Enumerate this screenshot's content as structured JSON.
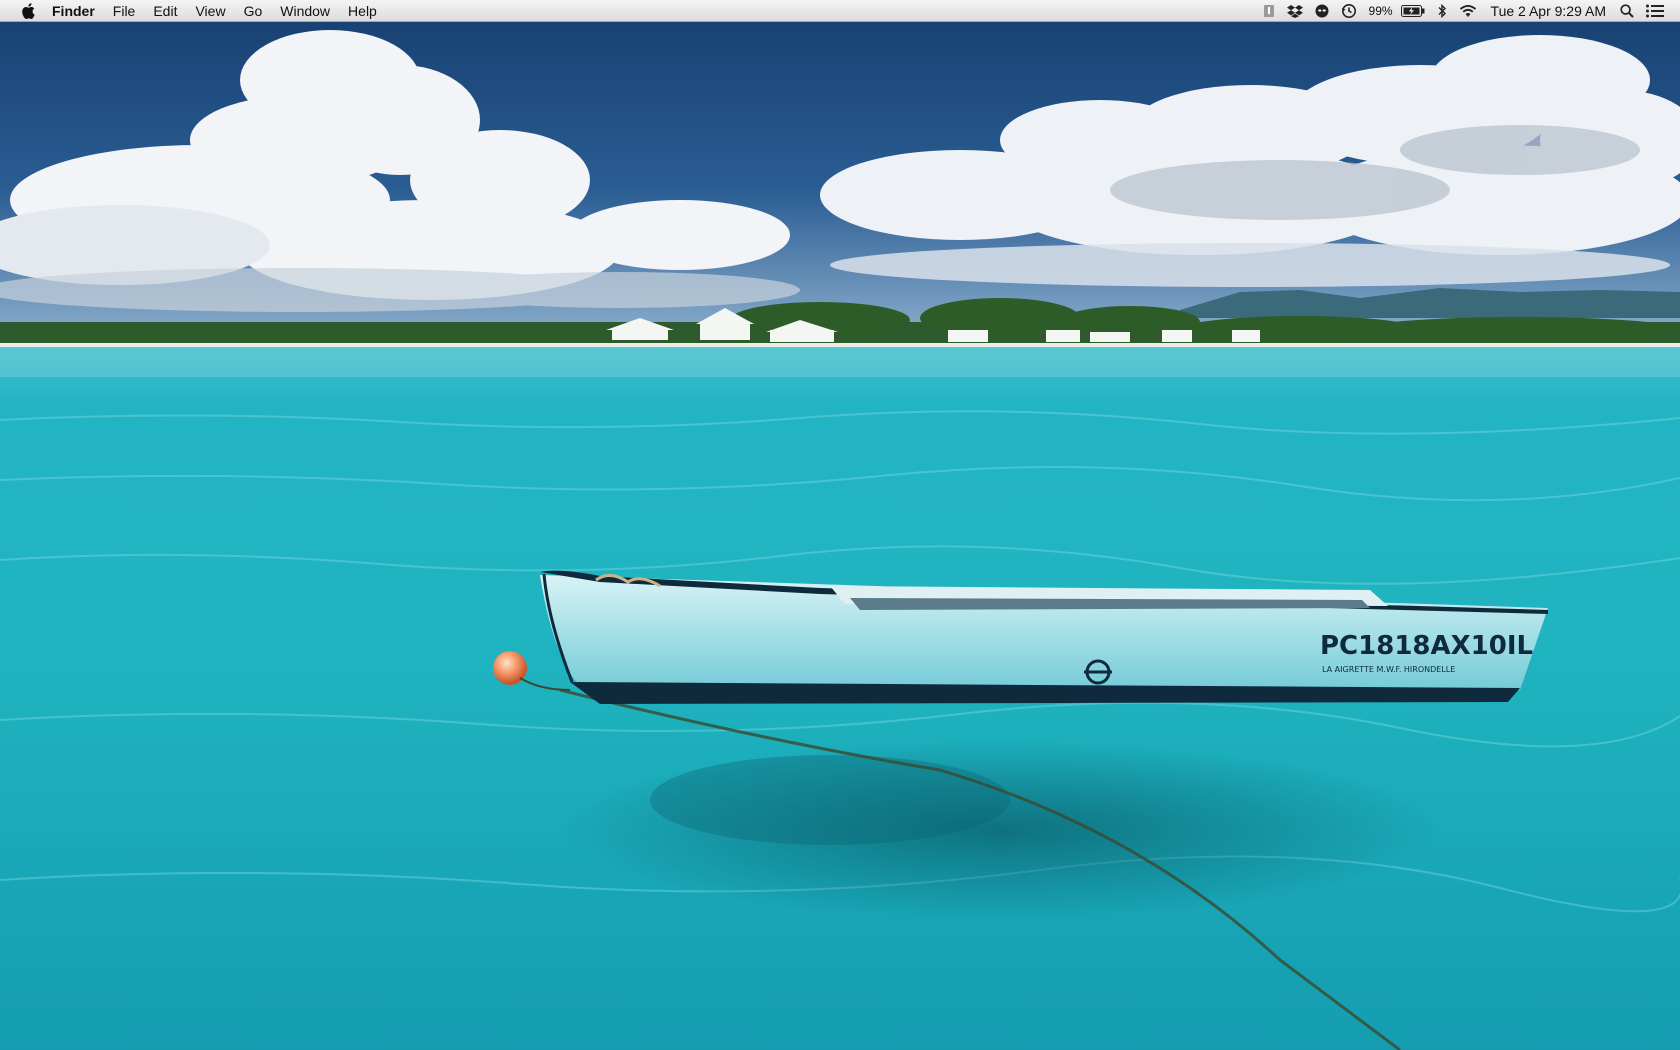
{
  "menubar": {
    "app_name": "Finder",
    "menus": [
      "File",
      "Edit",
      "View",
      "Go",
      "Window",
      "Help"
    ],
    "battery_percent": "99%",
    "clock": "Tue 2 Apr  9:29 AM"
  },
  "wallpaper": {
    "boat_registration": "PC1818AX10IL",
    "boat_subtitle": "LA AIGRETTE M.W.F. HIRONDELLE"
  },
  "colors": {
    "sea_deep": "#138fa8",
    "sea_light": "#2fc7d2",
    "sky": "#1f4f84",
    "boat_hull": "#7fd4e0"
  }
}
